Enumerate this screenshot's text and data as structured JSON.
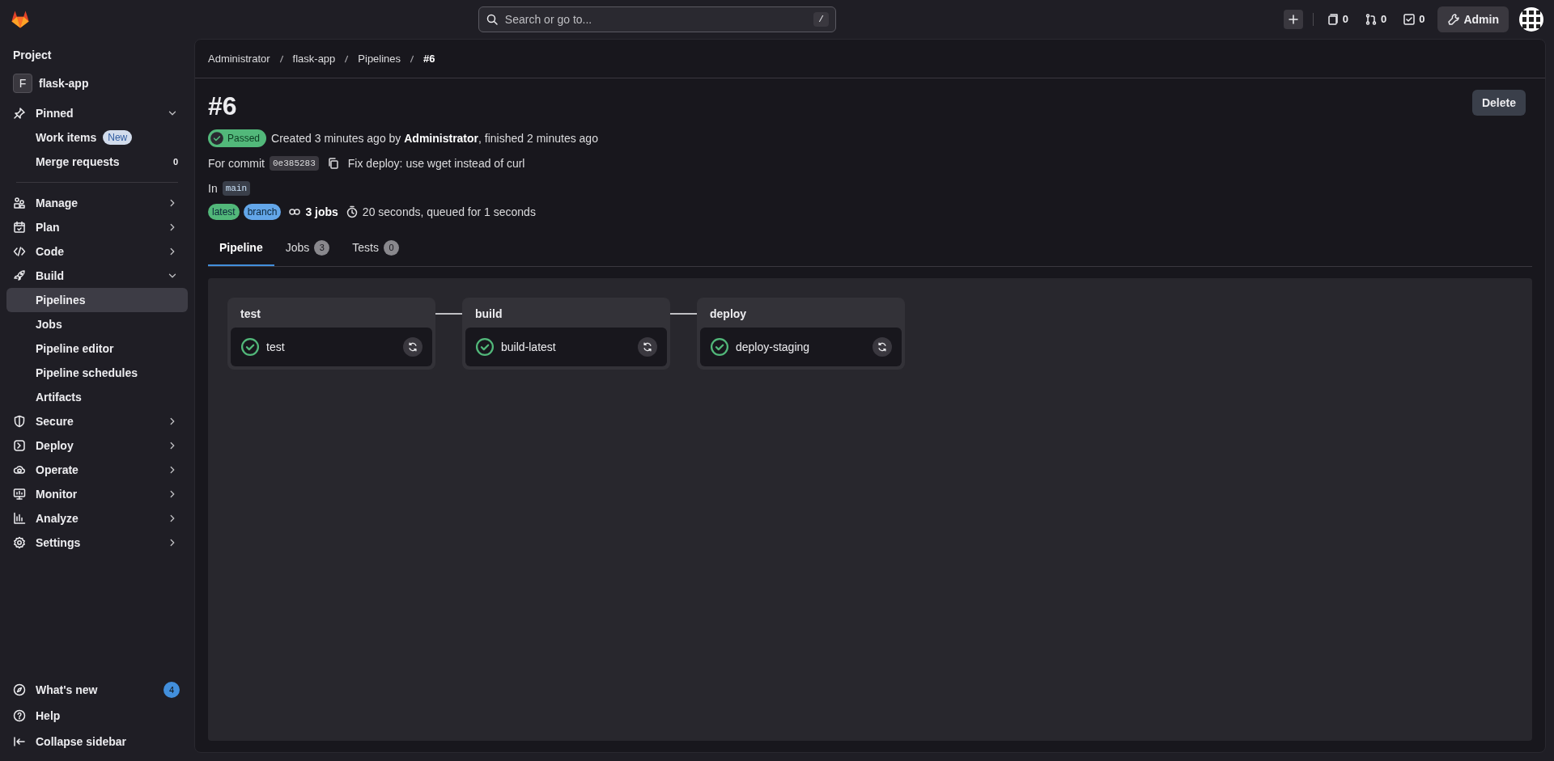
{
  "topbar": {
    "search_placeholder": "Search or go to...",
    "search_shortcut": "/",
    "counters": [
      {
        "count": "0"
      },
      {
        "count": "0"
      },
      {
        "count": "0"
      }
    ],
    "admin_button": "Admin"
  },
  "sidebar": {
    "heading": "Project",
    "project": {
      "initial": "F",
      "name": "flask-app"
    },
    "sections": [
      {
        "label": "Pinned",
        "expanded": true,
        "children": [
          {
            "label": "Work items",
            "badge": "New",
            "selected": false
          },
          {
            "label": "Merge requests",
            "count": "0",
            "selected": false
          }
        ]
      },
      {
        "label": "Manage",
        "expanded": false
      },
      {
        "label": "Plan",
        "expanded": false
      },
      {
        "label": "Code",
        "expanded": false
      },
      {
        "label": "Build",
        "expanded": true,
        "children": [
          {
            "label": "Pipelines",
            "selected": true
          },
          {
            "label": "Jobs",
            "selected": false
          },
          {
            "label": "Pipeline editor",
            "selected": false
          },
          {
            "label": "Pipeline schedules",
            "selected": false
          },
          {
            "label": "Artifacts",
            "selected": false
          }
        ]
      },
      {
        "label": "Secure",
        "expanded": false
      },
      {
        "label": "Deploy",
        "expanded": false
      },
      {
        "label": "Operate",
        "expanded": false
      },
      {
        "label": "Monitor",
        "expanded": false
      },
      {
        "label": "Analyze",
        "expanded": false
      },
      {
        "label": "Settings",
        "expanded": false
      }
    ],
    "footer": [
      {
        "label": "What's new",
        "badge": "4"
      },
      {
        "label": "Help"
      },
      {
        "label": "Collapse sidebar"
      }
    ]
  },
  "main": {
    "breadcrumbs": [
      "Administrator",
      "flask-app",
      "Pipelines",
      "#6"
    ],
    "title": "#6",
    "delete_button": "Delete",
    "status": {
      "label": "Passed",
      "kind": "passed"
    },
    "summary": "Created 3 minutes ago by **Administrator**, finished 2 minutes ago",
    "commit": {
      "label": "For commit",
      "sha": "0e385283",
      "message": "Fix deploy: use wget instead of curl"
    },
    "ref": {
      "label": "In",
      "name": "main"
    },
    "tags": [
      {
        "label": "latest",
        "color": "#52b87a"
      },
      {
        "label": "branch",
        "color": "#63a6e9"
      }
    ],
    "jobs_count": "3 jobs",
    "duration": "20 seconds, queued for 1 seconds",
    "tabs": [
      {
        "label": "Pipeline",
        "selected": true
      },
      {
        "label": "Jobs",
        "count": "3",
        "selected": false
      },
      {
        "label": "Tests",
        "count": "0",
        "selected": false
      }
    ],
    "stages": [
      {
        "name": "test",
        "jobs": [
          {
            "name": "test",
            "passed": true
          }
        ]
      },
      {
        "name": "build",
        "jobs": [
          {
            "name": "build-latest",
            "passed": true
          }
        ]
      },
      {
        "name": "deploy",
        "jobs": [
          {
            "name": "deploy-staging",
            "passed": true
          }
        ]
      }
    ]
  }
}
